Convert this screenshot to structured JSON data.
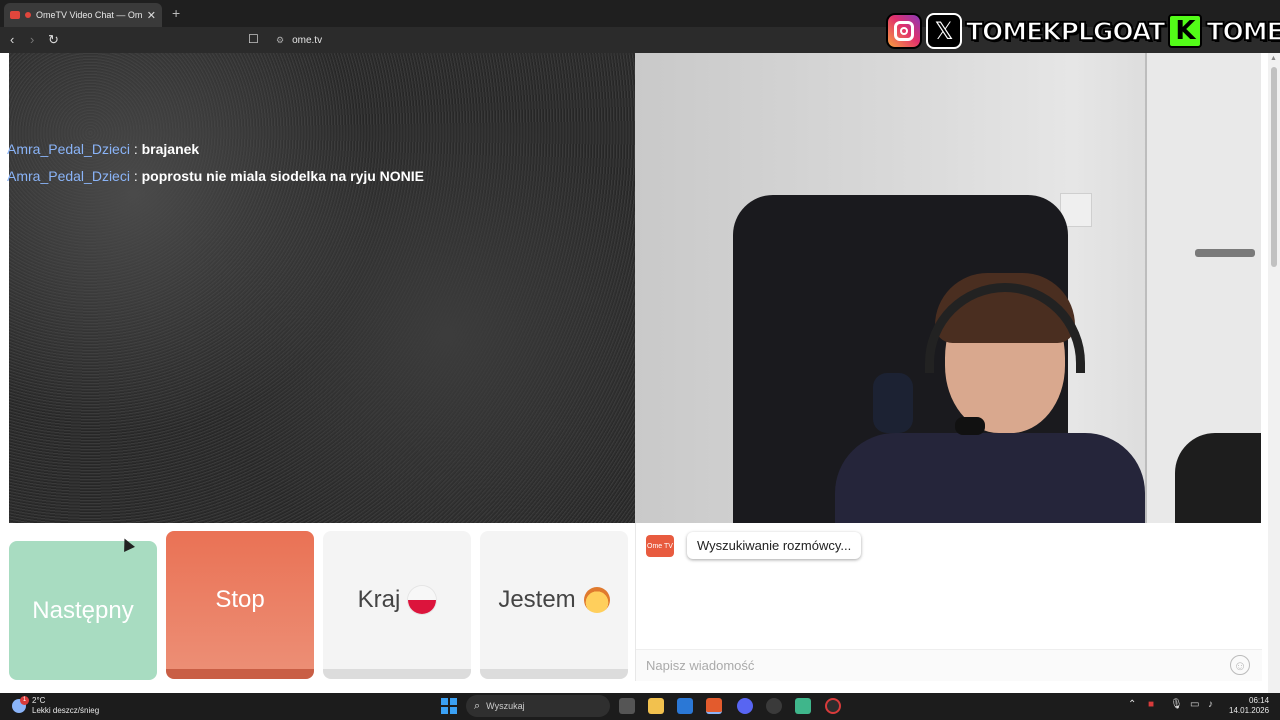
{
  "browser": {
    "tab_title": "OmeTV Video Chat — Omeg",
    "tab_close": "✕",
    "new_tab": "+",
    "back": "‹",
    "forward": "›",
    "reload": "↻",
    "url": "ome.tv",
    "window_controls": [
      "—",
      "☐",
      "✕"
    ]
  },
  "overlay": {
    "x_glyph": "𝕏",
    "handle_1": "TOMEKPLGOAT",
    "kick_glyph": "K",
    "handle_2": "TOMEKPL"
  },
  "chat_overlay": [
    {
      "user": "Amra_Pedal_Dzieci",
      "sep": " : ",
      "message": "brajanek"
    },
    {
      "user": "Amra_Pedal_Dzieci",
      "sep": " : ",
      "message": "poprostu nie miala siodelka na ryju NONIE"
    }
  ],
  "controls": {
    "next_label": "Następny",
    "stop_label": "Stop",
    "country_label": "Kraj",
    "gender_label": "Jestem"
  },
  "chat": {
    "logo_text": "Ome TV",
    "status_message": "Wyszukiwanie rozmówcy...",
    "input_placeholder": "Napisz wiadomość"
  },
  "taskbar": {
    "weather_badge": "1",
    "temperature": "2°C",
    "weather_desc": "Lekki deszcz/śnieg",
    "search_label": "Wyszukaj",
    "time": "06:14",
    "date": "14.01.2026"
  },
  "colors": {
    "next": "#a8dcc1",
    "stop": "#ea7255",
    "neutral_button": "#f4f4f4",
    "chat_user": "#8ab4f8"
  }
}
